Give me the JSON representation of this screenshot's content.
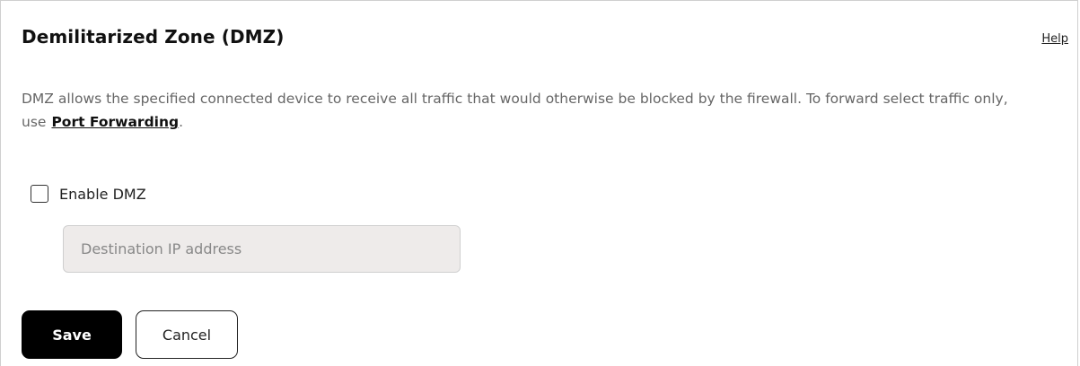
{
  "header": {
    "title": "Demilitarized Zone (DMZ)",
    "help_label": "Help"
  },
  "description": {
    "text": "DMZ allows the specified connected device to receive all traffic that would otherwise be blocked by the firewall. To forward select traffic only, use",
    "link_label": "Port Forwarding",
    "trailing": "."
  },
  "dmz": {
    "enable_label": "Enable DMZ",
    "enabled": false,
    "ip_value": "",
    "ip_placeholder": "Destination IP address"
  },
  "actions": {
    "save_label": "Save",
    "cancel_label": "Cancel"
  },
  "colors": {
    "primary_button": "#000000",
    "disabled_input_bg": "#eeebea",
    "description_text": "#666666"
  }
}
